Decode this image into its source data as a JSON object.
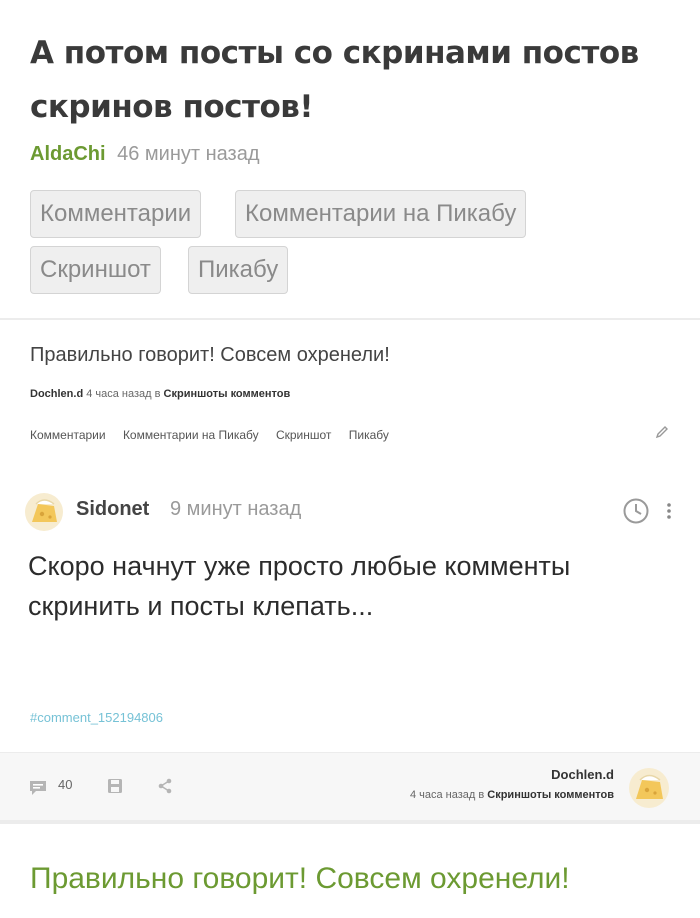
{
  "post": {
    "title": "А потом посты со скринами постов скринов постов!",
    "author": "AldaChi",
    "time": "46 минут назад",
    "tags": [
      "Комментарии",
      "Комментарии на Пикабу",
      "Скриншот",
      "Пикабу"
    ]
  },
  "screenshot": {
    "title": "Правильно говорит! Совсем охренели!",
    "meta_author": "Dochlen.d",
    "meta_time": "4 часа назад в",
    "meta_community": "Скриншоты комментов",
    "tags": [
      "Комментарии",
      "Комментарии на Пикабу",
      "Скриншот",
      "Пикабу"
    ],
    "comment": {
      "author": "Sidonet",
      "time": "9 минут назад",
      "text": "Скоро начнут уже просто любые комменты скринить и посты клепать...",
      "anchor": "#comment_152194806"
    },
    "actions": {
      "comments_count": "40",
      "author": "Dochlen.d",
      "meta_time": "4 часа назад в",
      "meta_community": "Скриншоты комментов"
    }
  },
  "bottom": {
    "quote": "Правильно говорит! Совсем охренели!"
  },
  "colors": {
    "accent_green": "#6c9a32",
    "link_blue": "#76c2d6",
    "tag_bg": "#efefef"
  }
}
